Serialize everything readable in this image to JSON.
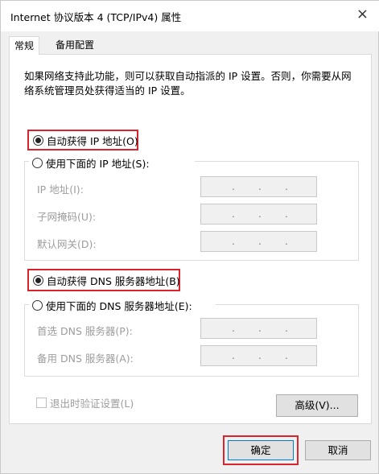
{
  "window": {
    "title": "Internet 协议版本 4 (TCP/IPv4) 属性",
    "close_glyph": "×"
  },
  "tabs": [
    {
      "label": "常规",
      "active": true
    },
    {
      "label": "备用配置",
      "active": false
    }
  ],
  "description": {
    "line1": "如果网络支持此功能，则可以获取自动指派的 IP 设置。否则，你需要从网",
    "line2": "络系统管理员处获得适当的 IP 设置。"
  },
  "ip_section": {
    "auto_label": "自动获得 IP 地址(O)",
    "auto_selected": true,
    "manual_label": "使用下面的 IP 地址(S):",
    "fields": [
      {
        "label": "IP 地址(I):"
      },
      {
        "label": "子网掩码(U):"
      },
      {
        "label": "默认网关(D):"
      }
    ]
  },
  "dns_section": {
    "auto_label": "自动获得 DNS 服务器地址(B)",
    "auto_selected": true,
    "manual_label": "使用下面的 DNS 服务器地址(E):",
    "fields": [
      {
        "label": "首选 DNS 服务器(P):"
      },
      {
        "label": "备用 DNS 服务器(A):"
      }
    ]
  },
  "ip_dot": ".",
  "validate_label": "退出时验证设置(L)",
  "advanced_label": "高级(V)...",
  "ok_label": "确定",
  "cancel_label": "取消",
  "colors": {
    "highlight": "#d9232d",
    "disabled_text": "#9d9d9d"
  }
}
